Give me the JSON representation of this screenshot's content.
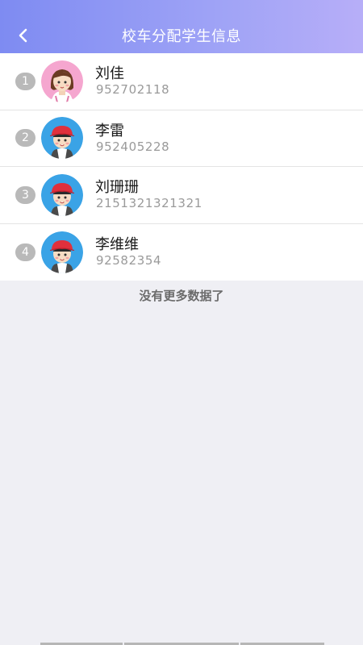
{
  "header": {
    "title": "校车分配学生信息",
    "back_icon": "chevron-left-icon"
  },
  "students": [
    {
      "index": "1",
      "name": "刘佳",
      "phone": "952702118",
      "avatar": "girl-avatar-icon"
    },
    {
      "index": "2",
      "name": "李雷",
      "phone": "952405228",
      "avatar": "boy-avatar-icon"
    },
    {
      "index": "3",
      "name": "刘珊珊",
      "phone": "2151321321321",
      "avatar": "boy-avatar-icon"
    },
    {
      "index": "4",
      "name": "李维维",
      "phone": "92582354",
      "avatar": "boy-avatar-icon"
    }
  ],
  "list_end_text": "没有更多数据了",
  "colors": {
    "header_start": "#7e8bf2",
    "header_end": "#b7aef8",
    "background": "#efeff4",
    "index_badge": "#b9b9b9"
  }
}
